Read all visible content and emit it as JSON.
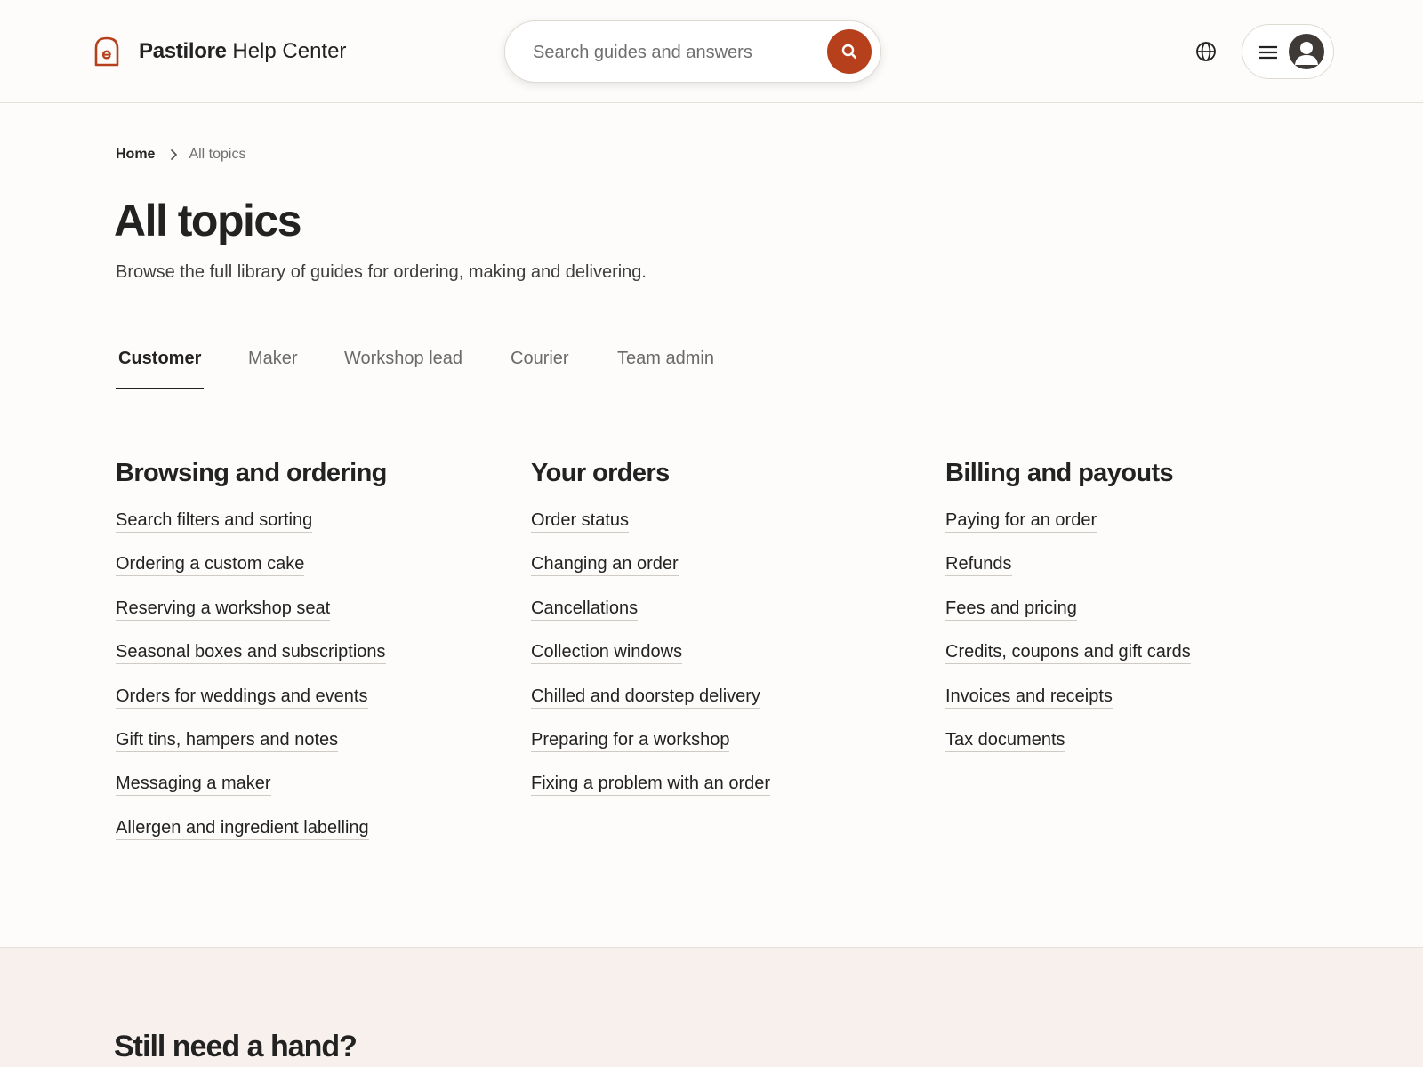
{
  "header": {
    "brand_name": "Pastilore",
    "brand_suffix": "Help Center",
    "logo_icon": "pastilore-logo",
    "search": {
      "placeholder": "Search guides and answers",
      "button_icon": "search-icon"
    },
    "language_icon": "globe-icon",
    "menu_icon": "hamburger-icon",
    "avatar_icon": "user-avatar-icon"
  },
  "breadcrumb": {
    "home": "Home",
    "separator_icon": "chevron-right-icon",
    "current": "All topics"
  },
  "page": {
    "title": "All topics",
    "subtitle": "Browse the full library of guides for ordering, making and delivering."
  },
  "tabs": [
    {
      "label": "Customer",
      "active": true
    },
    {
      "label": "Maker",
      "active": false
    },
    {
      "label": "Workshop lead",
      "active": false
    },
    {
      "label": "Courier",
      "active": false
    },
    {
      "label": "Team admin",
      "active": false
    }
  ],
  "columns": [
    {
      "title": "Browsing and ordering",
      "links": [
        "Search filters and sorting",
        "Ordering a custom cake",
        "Reserving a workshop seat",
        "Seasonal boxes and subscriptions",
        "Orders for weddings and events",
        "Gift tins, hampers and notes",
        "Messaging a maker",
        "Allergen and ingredient labelling"
      ]
    },
    {
      "title": "Your orders",
      "links": [
        "Order status",
        "Changing an order",
        "Cancellations",
        "Collection windows",
        "Chilled and doorstep delivery",
        "Preparing for a workshop",
        "Fixing a problem with an order"
      ]
    },
    {
      "title": "Billing and payouts",
      "links": [
        "Paying for an order",
        "Refunds",
        "Fees and pricing",
        "Credits, coupons and gift cards",
        "Invoices and receipts",
        "Tax documents"
      ]
    }
  ],
  "help": {
    "title": "Still need a hand?"
  },
  "colors": {
    "accent": "#b5401b",
    "text": "#222222",
    "muted": "#6f6f6f",
    "page_background": "#fdfcfa",
    "help_background": "#f8f0ec"
  }
}
